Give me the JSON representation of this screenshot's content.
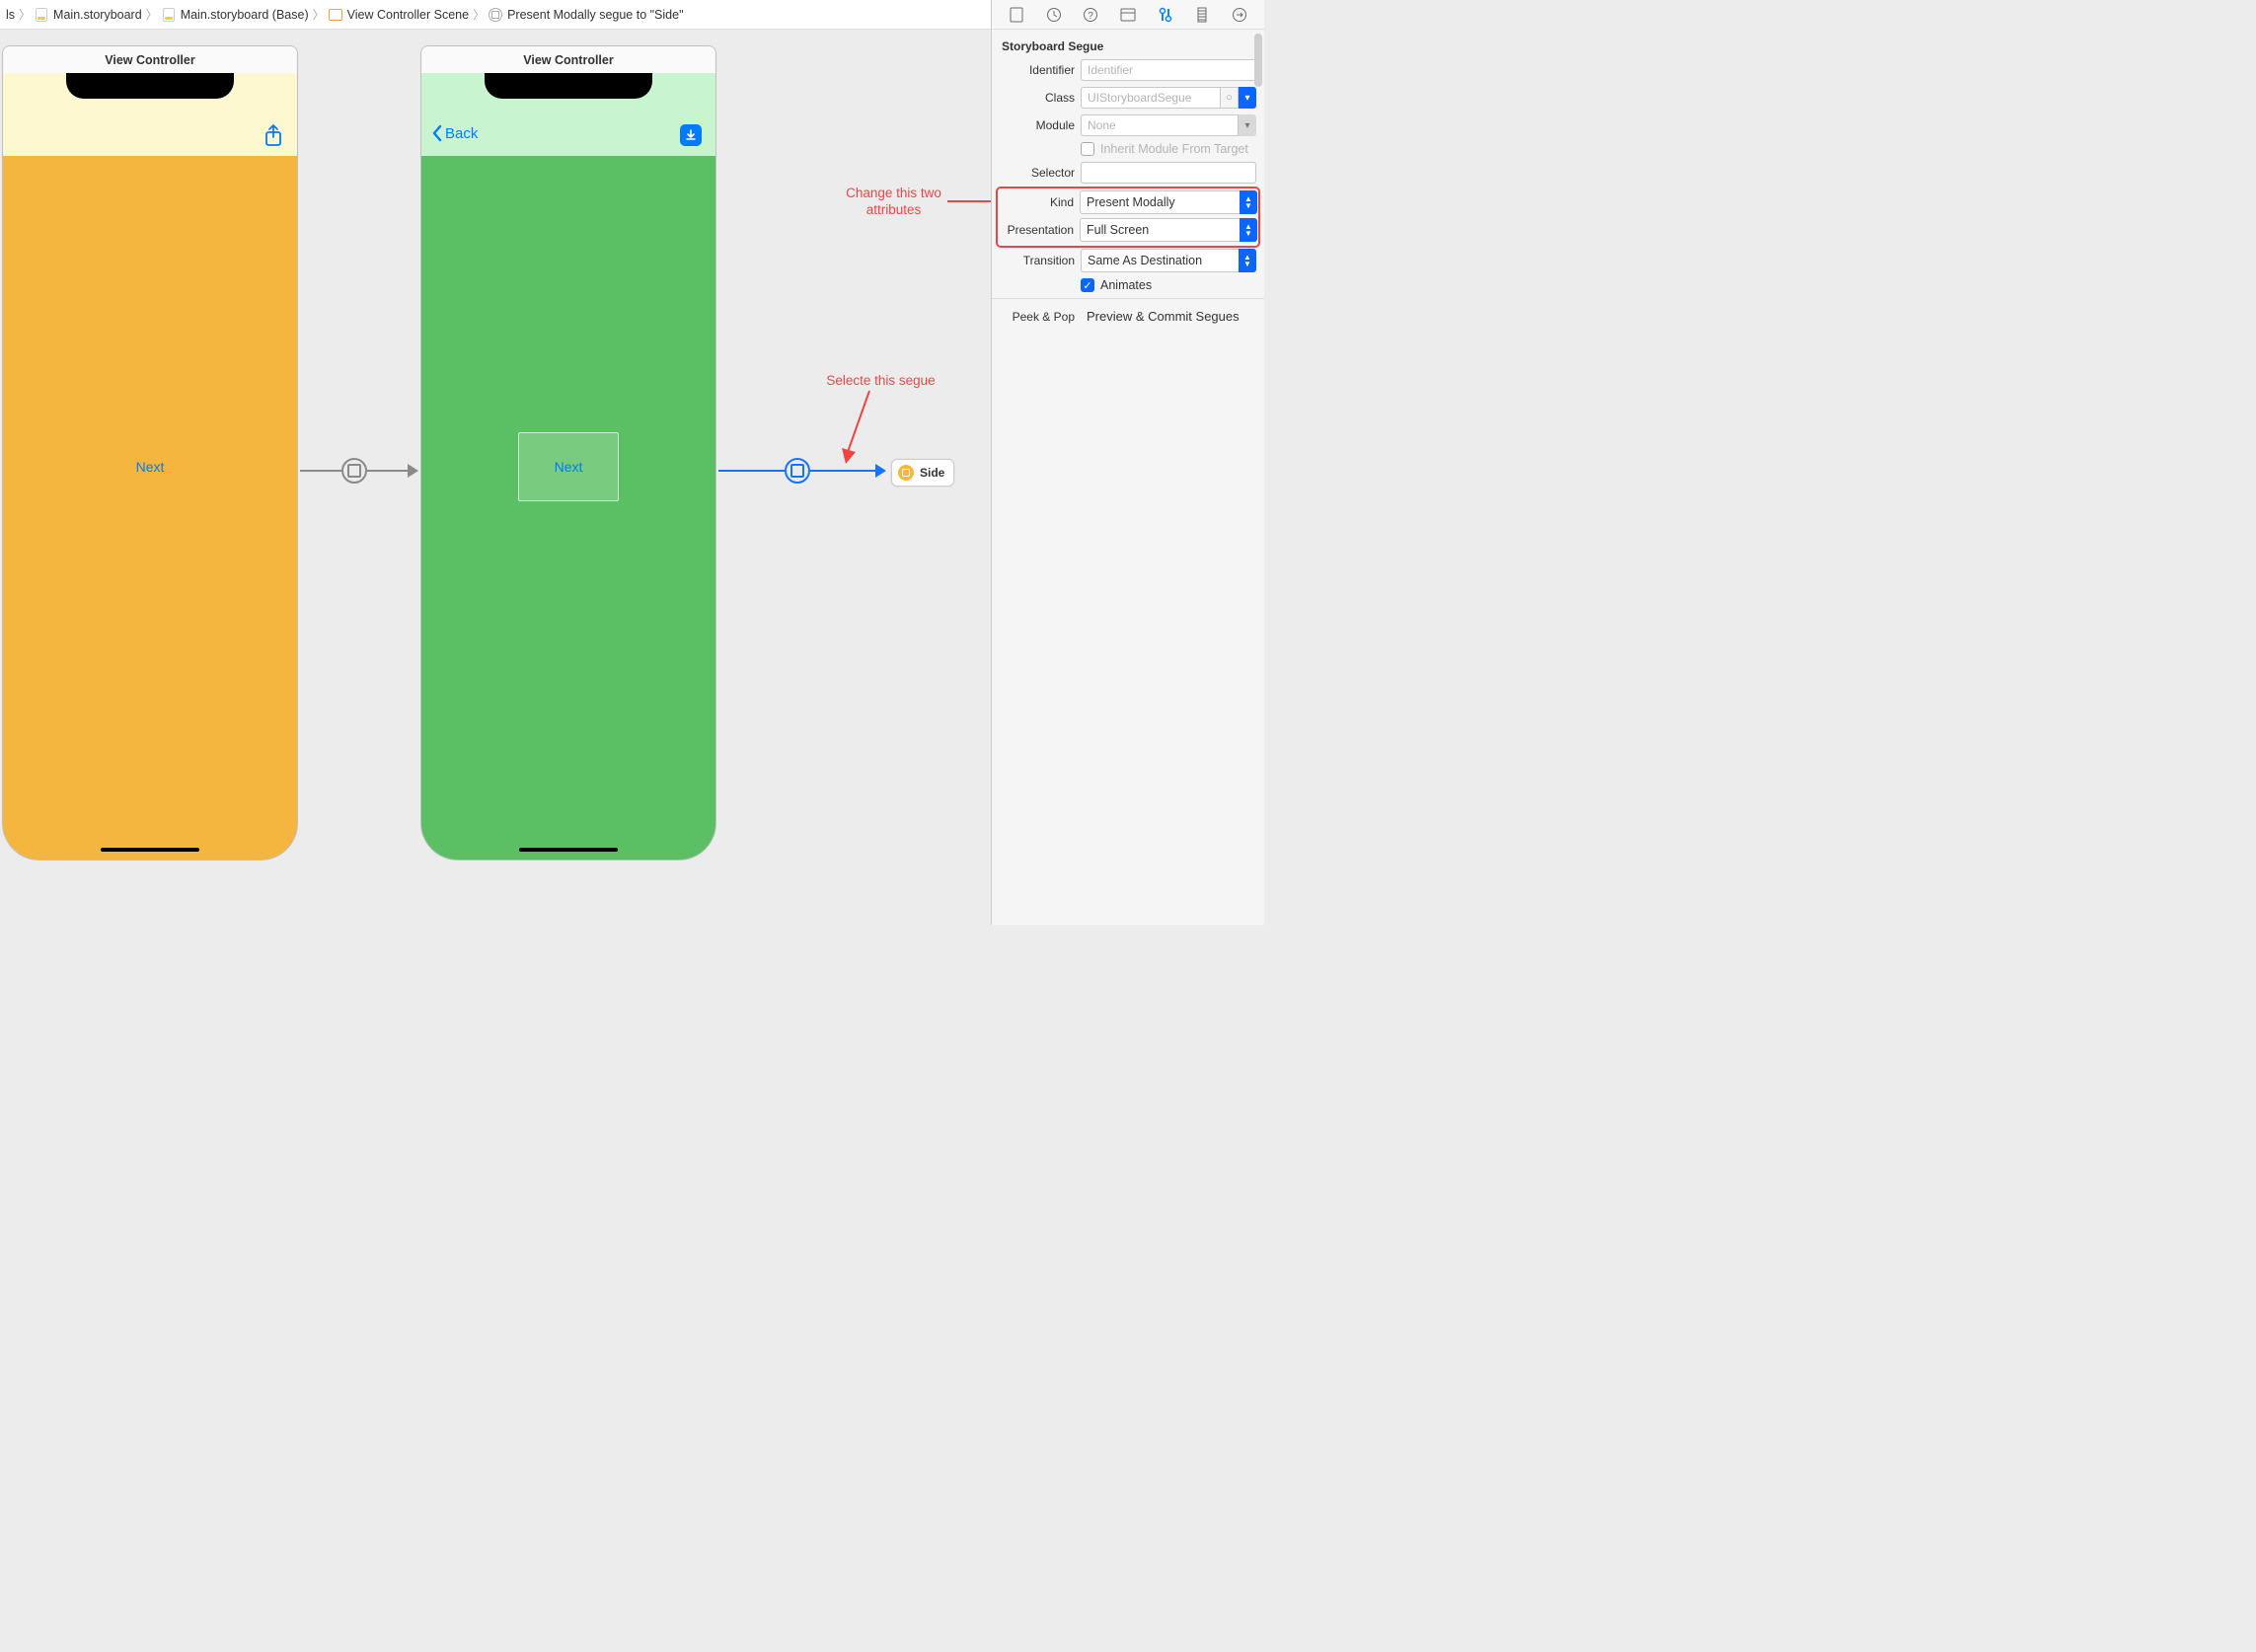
{
  "crumbs": {
    "c0": "ls",
    "c1": "Main.storyboard",
    "c2": "Main.storyboard (Base)",
    "c3": "View Controller Scene",
    "c4": "Present Modally segue to \"Side\""
  },
  "canvas": {
    "vc1": {
      "title": "View Controller",
      "next": "Next"
    },
    "vc2": {
      "title": "View Controller",
      "back": "Back",
      "next": "Next"
    },
    "sideRef": "Side"
  },
  "annot": {
    "a1": "Change this two attributes",
    "a2": "Selecte this segue"
  },
  "inspector": {
    "section": "Storyboard Segue",
    "identifier": {
      "label": "Identifier",
      "placeholder": "Identifier",
      "value": ""
    },
    "class": {
      "label": "Class",
      "value": "UIStoryboardSegue"
    },
    "module": {
      "label": "Module",
      "value": "None"
    },
    "inherit": {
      "label": "Inherit Module From Target"
    },
    "selector": {
      "label": "Selector",
      "value": ""
    },
    "kind": {
      "label": "Kind",
      "value": "Present Modally"
    },
    "presentation": {
      "label": "Presentation",
      "value": "Full Screen"
    },
    "transition": {
      "label": "Transition",
      "value": "Same As Destination"
    },
    "animates": {
      "label": "Animates"
    },
    "peekpop": {
      "label": "Peek & Pop",
      "option": "Preview & Commit Segues"
    }
  }
}
